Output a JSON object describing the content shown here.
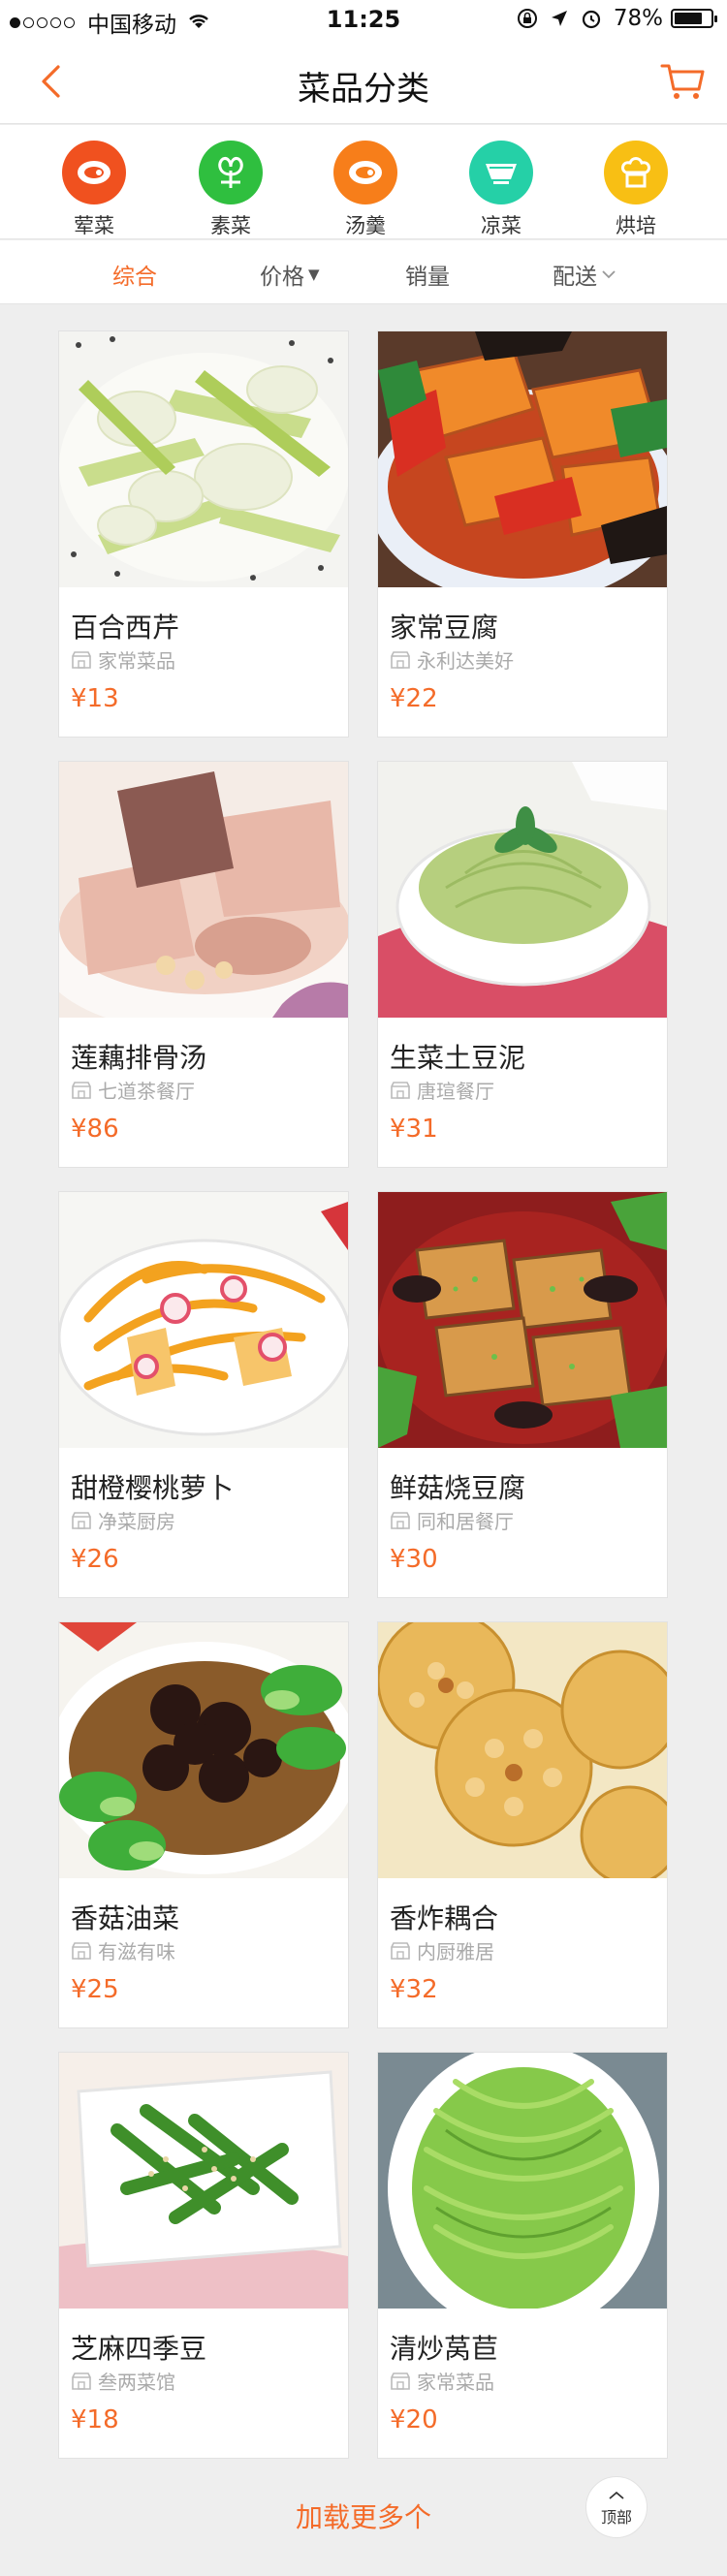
{
  "status_bar": {
    "carrier": "中国移动",
    "time": "11:25",
    "battery": "78%",
    "battery_level": 0.78
  },
  "header": {
    "title": "菜品分类",
    "back_icon": "chevron-left-icon",
    "cart_icon": "cart-icon"
  },
  "categories": [
    {
      "label": "荤菜",
      "icon": "meat-icon",
      "color": "#f0511f",
      "active": false
    },
    {
      "label": "素菜",
      "icon": "vegetable-icon",
      "color": "#2fbf3f",
      "active": true
    },
    {
      "label": "汤羹",
      "icon": "soup-icon",
      "color": "#f77e1a",
      "active": false
    },
    {
      "label": "凉菜",
      "icon": "bowl-icon",
      "color": "#25d0a7",
      "active": false
    },
    {
      "label": "烘培",
      "icon": "bread-icon",
      "color": "#f8bf14",
      "active": false
    }
  ],
  "sort": {
    "overall": "综合",
    "price": "价格",
    "sales": "销量",
    "delivery": "配送"
  },
  "dishes": [
    {
      "name": "百合西芹",
      "shop": "家常菜品",
      "price": "¥13"
    },
    {
      "name": "家常豆腐",
      "shop": "永利达美好",
      "price": "¥22"
    },
    {
      "name": "莲藕排骨汤",
      "shop": "七道茶餐厅",
      "price": "¥86"
    },
    {
      "name": "生菜土豆泥",
      "shop": "唐瑄餐厅",
      "price": "¥31"
    },
    {
      "name": "甜橙樱桃萝卜",
      "shop": "净菜厨房",
      "price": "¥26"
    },
    {
      "name": "鲜菇烧豆腐",
      "shop": "同和居餐厅",
      "price": "¥30"
    },
    {
      "name": "香菇油菜",
      "shop": "有滋有味",
      "price": "¥25"
    },
    {
      "name": "香炸耦合",
      "shop": "内厨雅居",
      "price": "¥32"
    },
    {
      "name": "芝麻四季豆",
      "shop": "叁两菜馆",
      "price": "¥18"
    },
    {
      "name": "清炒莴苣",
      "shop": "家常菜品",
      "price": "¥20"
    }
  ],
  "footer": {
    "load_more": "加载更多个",
    "to_top": "顶部"
  },
  "colors": {
    "accent": "#f46b29"
  }
}
